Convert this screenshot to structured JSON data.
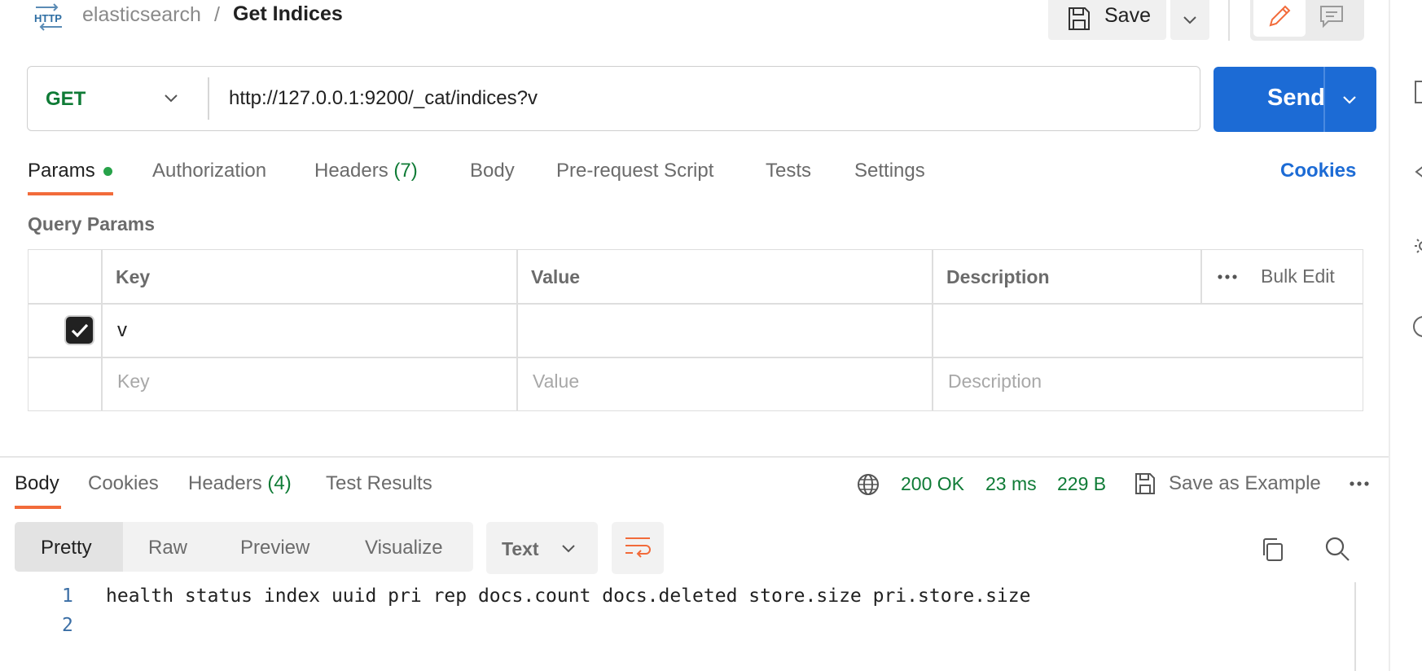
{
  "breadcrumb": {
    "protocol_badge": "HTTP",
    "collection": "elasticsearch",
    "separator": "/",
    "request_name": "Get Indices"
  },
  "header": {
    "save_label": "Save",
    "icons": [
      "save-icon",
      "chevron-down-icon",
      "pencil-icon",
      "comment-icon"
    ]
  },
  "request": {
    "method": "GET",
    "url": "http://127.0.0.1:9200/_cat/indices?v",
    "send_label": "Send"
  },
  "request_tabs": [
    {
      "label": "Params",
      "active": true,
      "dot": true
    },
    {
      "label": "Authorization"
    },
    {
      "label": "Headers",
      "count": "(7)"
    },
    {
      "label": "Body"
    },
    {
      "label": "Pre-request Script"
    },
    {
      "label": "Tests"
    },
    {
      "label": "Settings"
    }
  ],
  "cookies_link": "Cookies",
  "query_params": {
    "title": "Query Params",
    "headers": {
      "key": "Key",
      "value": "Value",
      "description": "Description",
      "bulk_edit": "Bulk Edit"
    },
    "rows": [
      {
        "checked": true,
        "key": "v",
        "value": "",
        "description": ""
      }
    ],
    "placeholders": {
      "key": "Key",
      "value": "Value",
      "description": "Description"
    }
  },
  "response": {
    "tabs": [
      {
        "label": "Body",
        "active": true
      },
      {
        "label": "Cookies"
      },
      {
        "label": "Headers",
        "count": "(4)"
      },
      {
        "label": "Test Results"
      }
    ],
    "status": "200 OK",
    "time": "23 ms",
    "size": "229 B",
    "save_example": "Save as Example",
    "formats": [
      "Pretty",
      "Raw",
      "Preview",
      "Visualize"
    ],
    "active_format": "Pretty",
    "text_type": "Text",
    "code": {
      "line_numbers": [
        "1",
        "2"
      ],
      "lines": [
        "health status index uuid pri rep docs.count docs.deleted store.size pri.store.size",
        ""
      ]
    }
  },
  "colors": {
    "accent_orange": "#f26b3a",
    "send_blue": "#1c6bd5",
    "get_green": "#0f7b36",
    "status_green": "#27a249"
  }
}
